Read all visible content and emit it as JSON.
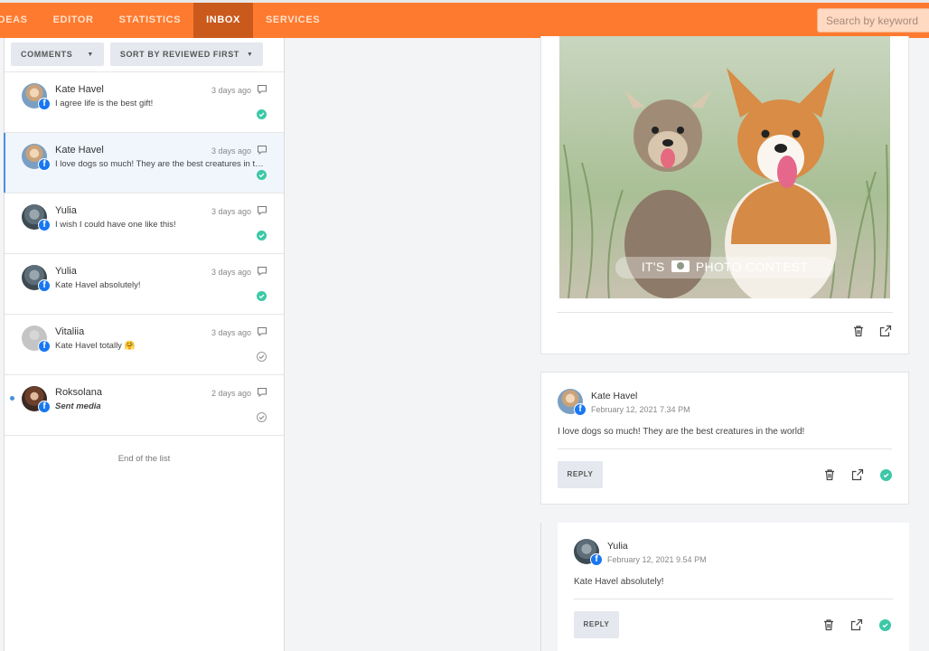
{
  "nav": {
    "items": [
      {
        "label": "IDEAS"
      },
      {
        "label": "EDITOR"
      },
      {
        "label": "STATISTICS"
      },
      {
        "label": "INBOX"
      },
      {
        "label": "SERVICES"
      }
    ],
    "active": "INBOX"
  },
  "search": {
    "placeholder": "Search by keyword"
  },
  "filters": {
    "type_label": "COMMENTS",
    "sort_label": "SORT BY REVIEWED FIRST"
  },
  "messages": [
    {
      "name": "Kate Havel",
      "text": "I agree life is the best gift!",
      "time": "3 days ago",
      "reviewed": true
    },
    {
      "name": "Kate Havel",
      "text": "I love dogs so much! They are the best creatures in the world!",
      "time": "3 days ago",
      "reviewed": true
    },
    {
      "name": "Yulia",
      "text": "I wish I could have one like this!",
      "time": "3 days ago",
      "reviewed": true
    },
    {
      "name": "Yulia",
      "text": "Kate Havel absolutely!",
      "time": "3 days ago",
      "reviewed": true
    },
    {
      "name": "Vitaliia",
      "text": "Kate Havel totally 🤗",
      "time": "3 days ago",
      "reviewed": false
    },
    {
      "name": "Roksolana",
      "text": "Sent media",
      "time": "2 days ago",
      "reviewed": false
    }
  ],
  "end_of_list": "End of the list",
  "post": {
    "overlay_text_left": "IT'S",
    "overlay_text_right": "PHOTO CONTEST"
  },
  "comment": {
    "name": "Kate Havel",
    "date": "February 12, 2021 7.34 PM",
    "text": "I love dogs so much! They are the best creatures in the world!",
    "reply_label": "REPLY"
  },
  "reply": {
    "name": "Yulia",
    "date": "February 12, 2021 9.54 PM",
    "text": "Kate Havel absolutely!",
    "reply_label": "REPLY"
  },
  "colors": {
    "brand": "#fe7a2f",
    "nav_active": "#c95a1c",
    "reviewed": "#3cc8a6",
    "facebook": "#1877f2",
    "selected_accent": "#4a90d9"
  }
}
